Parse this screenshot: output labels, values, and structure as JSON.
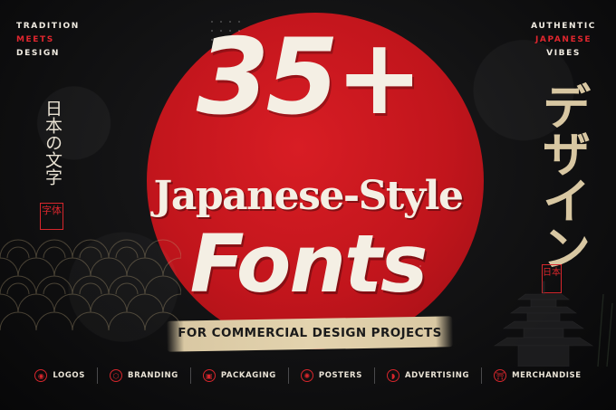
{
  "colors": {
    "accent": "#d7262c",
    "cream": "#f4efe4",
    "gold": "#d8c7a2",
    "background": "#111112"
  },
  "top_left": {
    "line1": "TRADITION",
    "line2": "MEETS",
    "line3": "DESIGN"
  },
  "top_right": {
    "line1": "AUTHENTIC",
    "line2": "JAPANESE",
    "line3": "VIBES"
  },
  "left_vertical_text": "日本の文字",
  "left_seal": "字体",
  "right_vertical_text": "デザイン",
  "right_seal": "日本",
  "headline": {
    "number": "35+",
    "middle": "Japanese-Style",
    "bottom": "Fonts"
  },
  "tagline": "FOR COMMERCIAL DESIGN PROJECTS",
  "categories": [
    {
      "label": "LOGOS",
      "icon": "logos-icon",
      "glyph": "◉"
    },
    {
      "label": "BRANDING",
      "icon": "branding-icon",
      "glyph": "⬡"
    },
    {
      "label": "PACKAGING",
      "icon": "packaging-icon",
      "glyph": "▣"
    },
    {
      "label": "POSTERS",
      "icon": "posters-icon",
      "glyph": "✺"
    },
    {
      "label": "ADVERTISING",
      "icon": "fan-icon",
      "glyph": "◗"
    },
    {
      "label": "MERCHANDISE",
      "icon": "torii-icon",
      "glyph": "⛩"
    }
  ]
}
